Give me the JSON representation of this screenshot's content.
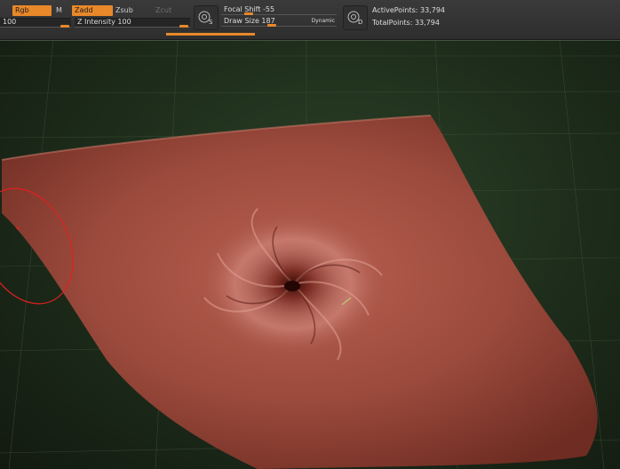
{
  "toolbar": {
    "rgb_label": "Rgb",
    "m_label": "M",
    "zadd_label": "Zadd",
    "zsub_label": "Zsub",
    "zcut_label": "Zcut",
    "left_slider_value": "100",
    "z_intensity_label": "Z Intensity 100",
    "focal_shift_label": "Focal Shift -55",
    "draw_size_label": "Draw Size 187",
    "dynamic_label": "Dynamic",
    "s_button_letter": "S",
    "d_button_letter": "D",
    "active_points": "ActivePoints: 33,794",
    "total_points": "TotalPoints: 33,794"
  },
  "colors": {
    "accent": "#e8882a",
    "model": "#9b4a3c",
    "background": "#1f2f1c",
    "brush_cursor": "#e02020"
  }
}
